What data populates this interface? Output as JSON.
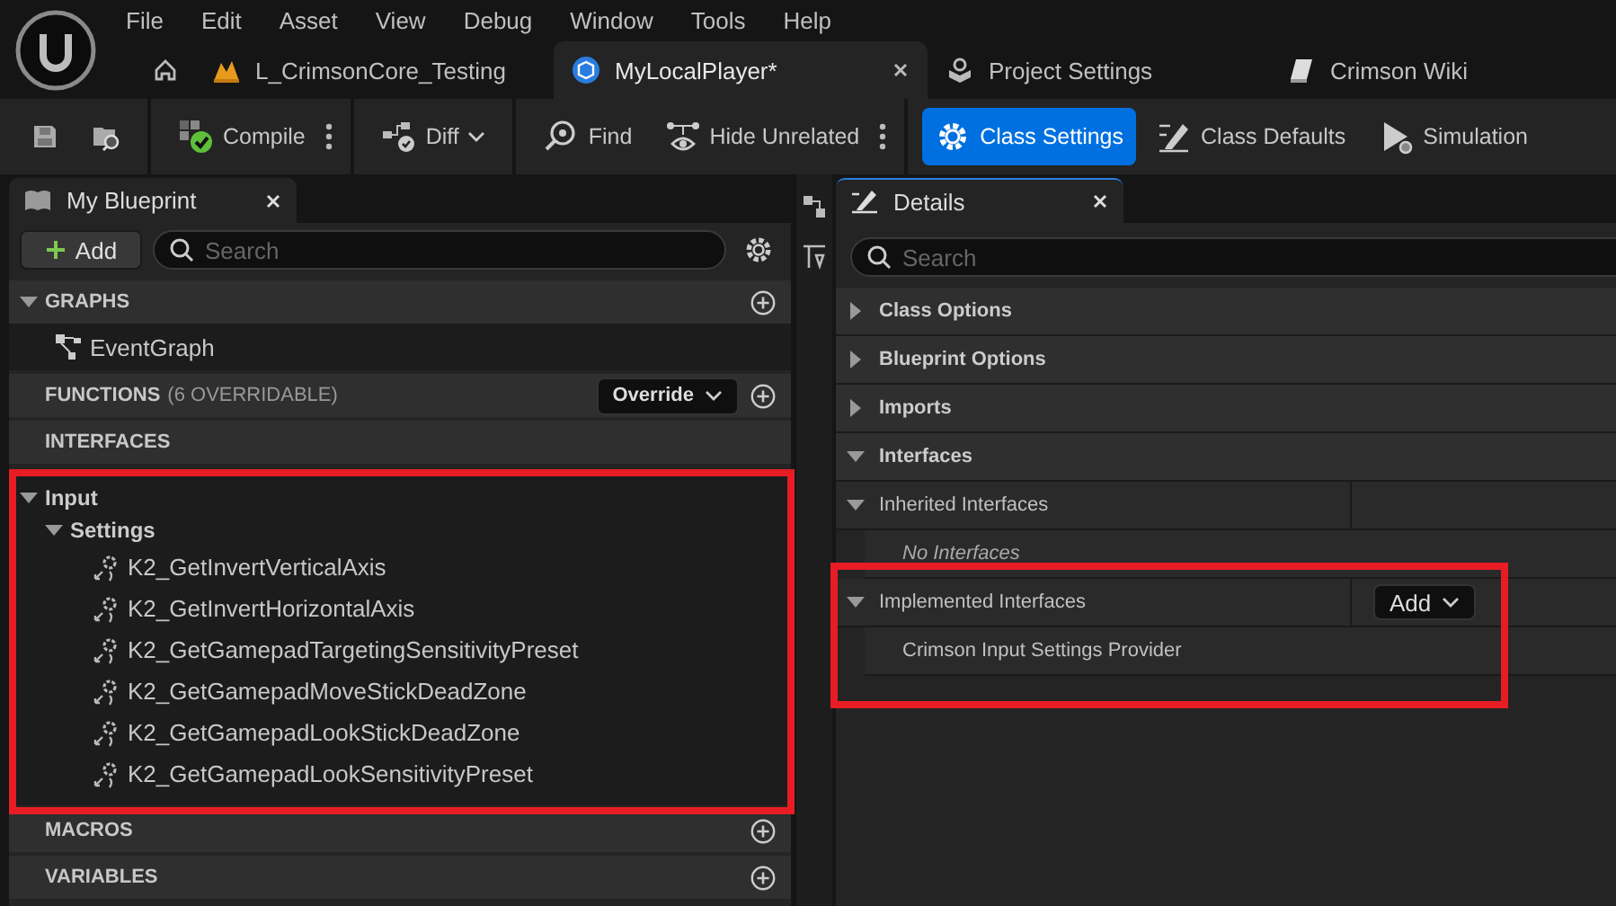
{
  "menu": [
    "File",
    "Edit",
    "Asset",
    "View",
    "Debug",
    "Window",
    "Tools",
    "Help"
  ],
  "doc_tabs": [
    {
      "kind": "home",
      "selected": false
    },
    {
      "kind": "level",
      "label": "L_CrimsonCore_Testing",
      "selected": false
    },
    {
      "kind": "blueprint",
      "label": "MyLocalPlayer*",
      "selected": true
    },
    {
      "kind": "settings",
      "label": "Project Settings",
      "selected": false
    },
    {
      "kind": "wiki",
      "label": "Crimson Wiki",
      "selected": false
    }
  ],
  "toolbar": [
    {
      "kind": "save",
      "selected": false
    },
    {
      "kind": "browse",
      "selected": false,
      "separator": true
    },
    {
      "kind": "compile",
      "label": "Compile",
      "selected": false,
      "more": true,
      "separator": true
    },
    {
      "kind": "diff",
      "label": "Diff",
      "selected": false,
      "dropdown": true,
      "separator": true
    },
    {
      "kind": "find",
      "label": "Find",
      "selected": false
    },
    {
      "kind": "hide",
      "label": "Hide Unrelated",
      "selected": false,
      "more": true,
      "separator": true
    },
    {
      "kind": "class_settings",
      "label": "Class Settings",
      "selected": true
    },
    {
      "kind": "class_defaults",
      "label": "Class Defaults",
      "selected": false
    },
    {
      "kind": "simulation",
      "label": "Simulation",
      "selected": false
    }
  ],
  "my_blueprint": {
    "tab": "My Blueprint",
    "add_button": "Add",
    "search_placeholder": "Search",
    "sections": [
      {
        "kind": "header",
        "title": "GRAPHS",
        "expanded": true,
        "add": true,
        "items": [
          {
            "label": "EventGraph"
          }
        ]
      },
      {
        "kind": "header",
        "title": "FUNCTIONS",
        "note": "(6 OVERRIDABLE)",
        "menu_button": "Override",
        "add": true
      },
      {
        "kind": "header",
        "title": "INTERFACES"
      },
      {
        "kind": "tree",
        "nodes": [
          {
            "label": "Input",
            "expanded": true,
            "children": [
              {
                "label": "Settings",
                "expanded": true,
                "children": [
                  {
                    "label": "K2_GetInvertVerticalAxis"
                  },
                  {
                    "label": "K2_GetInvertHorizontalAxis"
                  },
                  {
                    "label": "K2_GetGamepadTargetingSensitivityPreset"
                  },
                  {
                    "label": "K2_GetGamepadMoveStickDeadZone"
                  },
                  {
                    "label": "K2_GetGamepadLookStickDeadZone"
                  },
                  {
                    "label": "K2_GetGamepadLookSensitivityPreset"
                  }
                ]
              }
            ]
          }
        ]
      },
      {
        "kind": "header",
        "title": "MACROS",
        "add": true
      },
      {
        "kind": "header",
        "title": "VARIABLES",
        "add": true
      }
    ]
  },
  "details": {
    "tab": "Details",
    "search_placeholder": "Search",
    "categories": [
      {
        "title": "Class Options",
        "expanded": false
      },
      {
        "title": "Blueprint Options",
        "expanded": false
      },
      {
        "title": "Imports",
        "expanded": false
      },
      {
        "title": "Interfaces",
        "expanded": true,
        "subsections": [
          {
            "title": "Inherited Interfaces",
            "expanded": true,
            "rows": [
              {
                "kind": "empty",
                "text": "No Interfaces"
              }
            ]
          },
          {
            "title": "Implemented Interfaces",
            "expanded": true,
            "add_button": "Add",
            "rows": [
              {
                "kind": "entry",
                "text": "Crimson Input Settings Provider"
              }
            ]
          }
        ]
      }
    ]
  }
}
